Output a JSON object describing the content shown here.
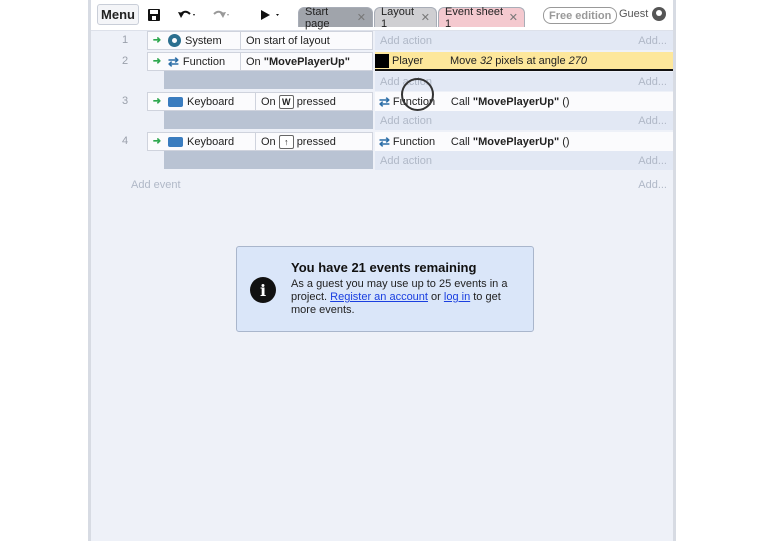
{
  "toolbar": {
    "menu_label": "Menu",
    "tabs": [
      {
        "label": "Start page"
      },
      {
        "label": "Layout 1"
      },
      {
        "label": "Event sheet 1"
      }
    ],
    "edition_badge": "Free edition",
    "guest_label": "Guest"
  },
  "events": [
    {
      "num": "1",
      "object": "System",
      "condition": "On start of layout",
      "add_action": "Add action",
      "add_short": "Add..."
    },
    {
      "num": "2",
      "object": "Function",
      "condition_prefix": "On ",
      "condition_bold": "\"MovePlayerUp\"",
      "action_object": "Player",
      "action_prefix": "Move ",
      "action_num": "32",
      "action_mid": " pixels at angle ",
      "action_angle": "270",
      "add_action": "Add action",
      "add_short": "Add..."
    },
    {
      "num": "3",
      "object": "Keyboard",
      "condition_prefix": "On",
      "key": "W",
      "condition_suffix": "pressed",
      "action_object": "Function",
      "action_prefix": "Call ",
      "action_bold": "\"MovePlayerUp\"",
      "action_suffix": " ()",
      "add_action": "Add action",
      "add_short": "Add..."
    },
    {
      "num": "4",
      "object": "Keyboard",
      "condition_prefix": "On",
      "key": "↑",
      "condition_suffix": "pressed",
      "action_object": "Function",
      "action_prefix": "Call ",
      "action_bold": "\"MovePlayerUp\"",
      "action_suffix": " ()",
      "add_action": "Add action",
      "add_short": "Add..."
    }
  ],
  "add_event": {
    "label": "Add event",
    "short": "Add..."
  },
  "notice": {
    "title": "You have 21 events remaining",
    "body_1": "As a guest you may use up to 25 events in a project. ",
    "link_register": "Register an account",
    "body_2": " or ",
    "link_login": "log in",
    "body_3": " to get more events.",
    "icon": "i"
  },
  "colors": {
    "highlight": "#fde79b",
    "notice_bg": "#dae6f9",
    "link": "#1a3fe0"
  }
}
